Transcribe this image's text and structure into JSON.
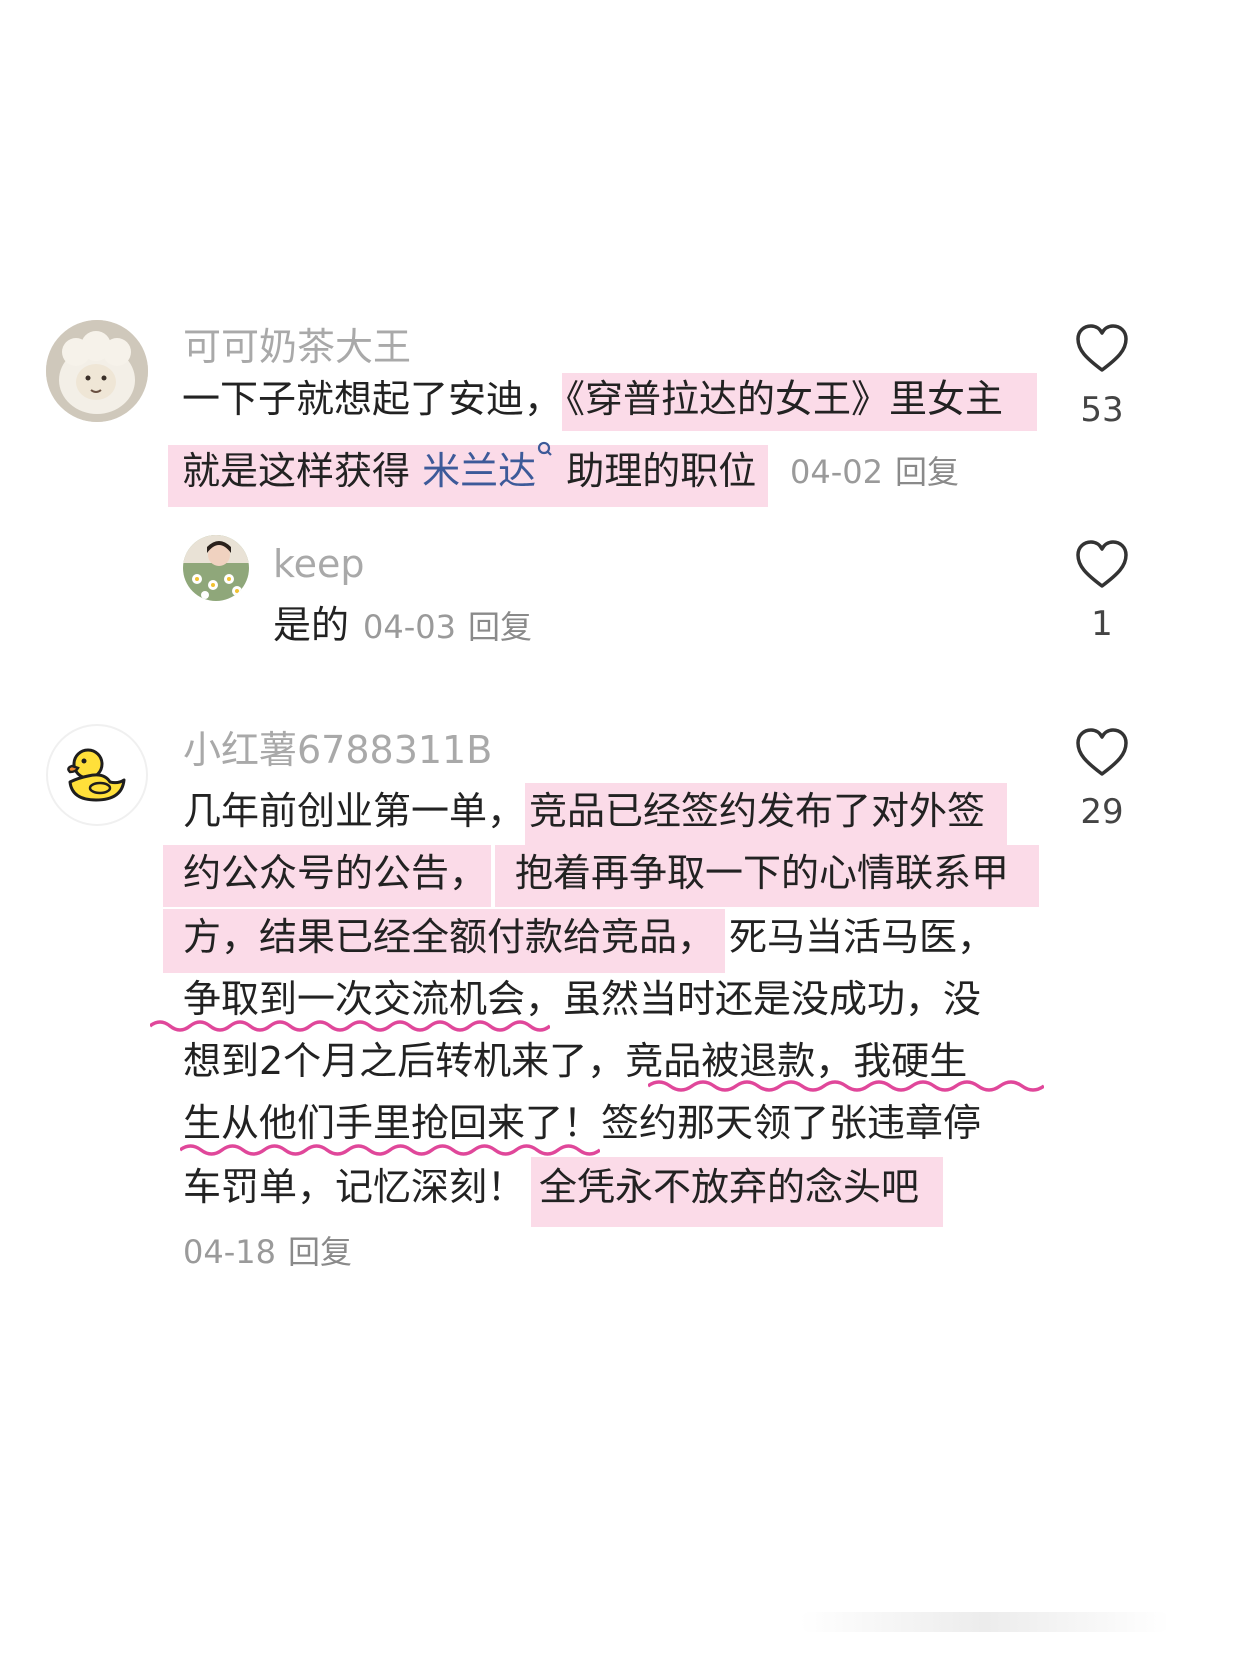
{
  "comments": [
    {
      "username": "可可奶茶大王",
      "avatar_icon": "sheep-plush-avatar",
      "lines": [
        [
          "一下子就想起了安迪，",
          "《穿普拉达的女王》里女主"
        ],
        [
          "就是这样获得 ",
          "米兰达",
          " 助理的职位"
        ]
      ],
      "date": "04-02",
      "reply_label": "回复",
      "likes": "53"
    },
    {
      "username": "keep",
      "avatar_icon": "flower-girl-avatar",
      "text": "是的",
      "date": "04-03",
      "reply_label": "回复",
      "likes": "1"
    },
    {
      "username": "小红薯6788311B",
      "avatar_icon": "yellow-duck-avatar",
      "lines": [
        [
          "几年前创业第一单，",
          "竞品已经签约发布了对外签"
        ],
        [
          "约公众号的公告，",
          "抱着再争取一下的心情联系甲"
        ],
        [
          "方，结果已经全额付款给竞品，",
          "死马当活马医，"
        ],
        [
          "争取到一次交流机会",
          "，虽然当时还是没成功，没"
        ],
        [
          "想到2个月之后转机来了，",
          "竞品被退款，我硬生"
        ],
        [
          "生从他们手里抢回来了！",
          "签约那天领了张违章停"
        ],
        [
          "车罚单，记忆深刻！",
          "全凭永不放弃的念头吧"
        ]
      ],
      "date": "04-18",
      "reply_label": "回复",
      "likes": "29"
    }
  ],
  "colors": {
    "highlight": "#fbdbe8",
    "underline": "#e0479a",
    "link": "#3d5a99",
    "username": "#a9a9a9"
  },
  "icons": [
    "heart-outline-icon",
    "search-small-icon"
  ]
}
